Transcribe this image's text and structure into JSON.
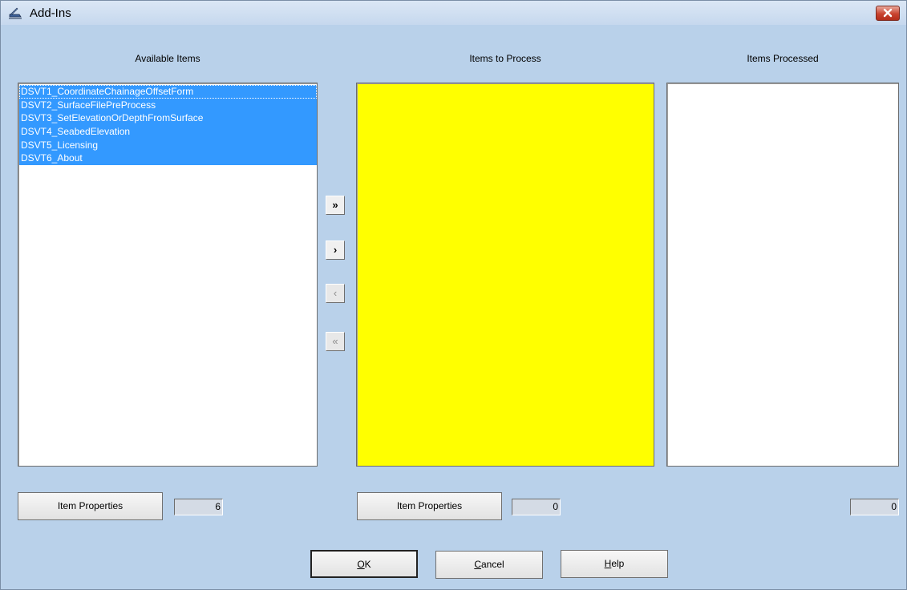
{
  "window": {
    "title": "Add-Ins"
  },
  "columns": {
    "available": {
      "label": "Available Items",
      "items": [
        "DSVT1_CoordinateChainageOffsetForm",
        "DSVT2_SurfaceFilePreProcess",
        "DSVT3_SetElevationOrDepthFromSurface",
        "DSVT4_SeabedElevation",
        "DSVT5_Licensing",
        "DSVT6_About"
      ],
      "properties_button": "Item Properties",
      "count": "6"
    },
    "to_process": {
      "label": "Items to Process",
      "background": "#ffff00",
      "properties_button": "Item Properties",
      "count": "0"
    },
    "processed": {
      "label": "Items Processed",
      "count": "0"
    }
  },
  "transfer": {
    "add_all": "»",
    "add": "›",
    "remove": "‹",
    "remove_all": "«"
  },
  "footer": {
    "ok_accel": "O",
    "ok_rest": "K",
    "cancel_accel": "C",
    "cancel_rest": "ancel",
    "help_accel": "H",
    "help_rest": "elp"
  },
  "colors": {
    "dialog_bg": "#b9d1ea",
    "selection": "#3399ff",
    "close_button": "#c9432f"
  },
  "icons": [
    "window-app-icon",
    "close-icon"
  ]
}
